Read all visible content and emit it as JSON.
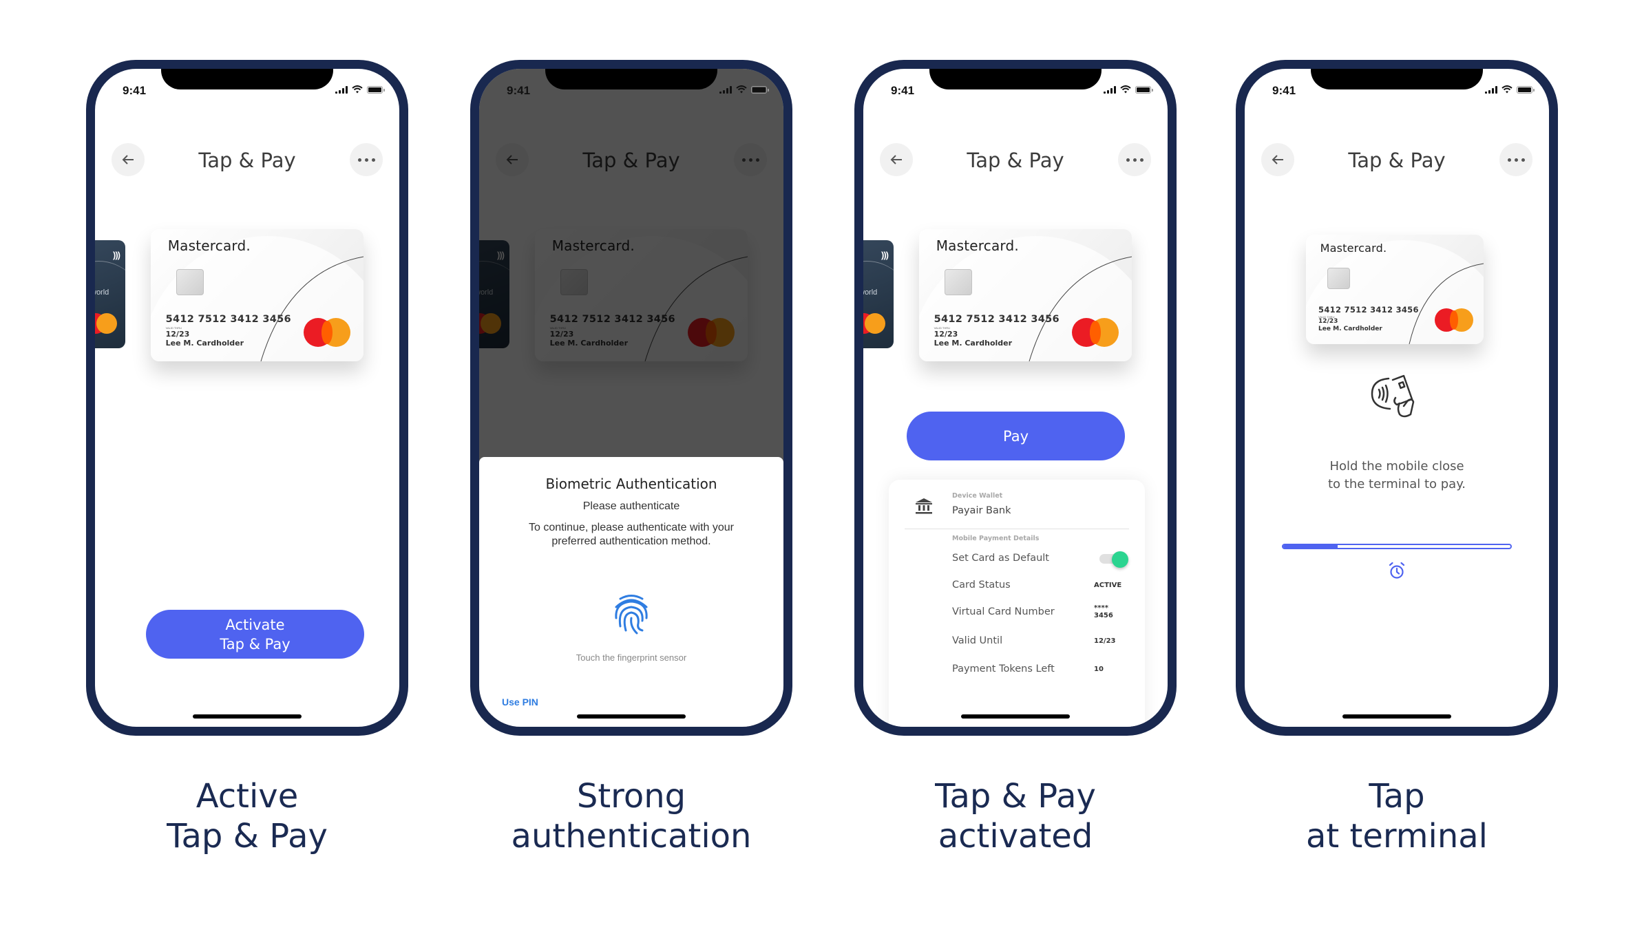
{
  "colors": {
    "phone_frame": "#19284f",
    "accent": "#4f63f0",
    "caption": "#1a2a52",
    "toggle_on": "#2bd490",
    "link": "#2f7de1",
    "mastercard_red": "#eb1c24",
    "mastercard_yellow": "#f79e1b"
  },
  "status_bar": {
    "time": "9:41",
    "icons": [
      "signal-icon",
      "wifi-icon",
      "battery-icon"
    ]
  },
  "header": {
    "title": "Tap & Pay",
    "back_icon": "arrow-left-icon",
    "more_icon": "more-horizontal-icon"
  },
  "card": {
    "brand": "Mastercard.",
    "number": "5412 7512 3412 3456",
    "valid_thru_label": "VALID THRU",
    "expiry": "12/23",
    "holder": "Lee M. Cardholder",
    "back_card_text": "world"
  },
  "screens": [
    {
      "id": "activate",
      "button_line1": "Activate",
      "button_line2": "Tap & Pay",
      "caption_line1": "Active",
      "caption_line2": "Tap & Pay"
    },
    {
      "id": "authentication",
      "dialog": {
        "title": "Biometric Authentication",
        "subtitle": "Please authenticate",
        "body": "To continue, please authenticate with your preferred authentication method.",
        "hint": "Touch the fingerprint sensor",
        "use_pin": "Use PIN",
        "icon": "fingerprint-icon"
      },
      "caption_line1": "Strong",
      "caption_line2": "authentication"
    },
    {
      "id": "activated",
      "pay_button": "Pay",
      "details": {
        "wallet_label": "Device Wallet",
        "wallet_value": "Payair Bank",
        "section_label": "Mobile Payment Details",
        "rows": [
          {
            "label": "Set Card as Default",
            "value": "",
            "toggle": true,
            "toggle_on": true
          },
          {
            "label": "Card Status",
            "value": "ACTIVE"
          },
          {
            "label": "Virtual Card Number",
            "value": "**** 3456"
          },
          {
            "label": "Valid Until",
            "value": "12/23"
          },
          {
            "label": "Payment Tokens Left",
            "value": "10"
          }
        ]
      },
      "caption_line1": "Tap & Pay",
      "caption_line2": "activated"
    },
    {
      "id": "terminal",
      "instruction_line1": "Hold the mobile close",
      "instruction_line2": "to the terminal to pay.",
      "progress_percent": 24,
      "caption_line1": "Tap",
      "caption_line2": "at terminal"
    }
  ]
}
